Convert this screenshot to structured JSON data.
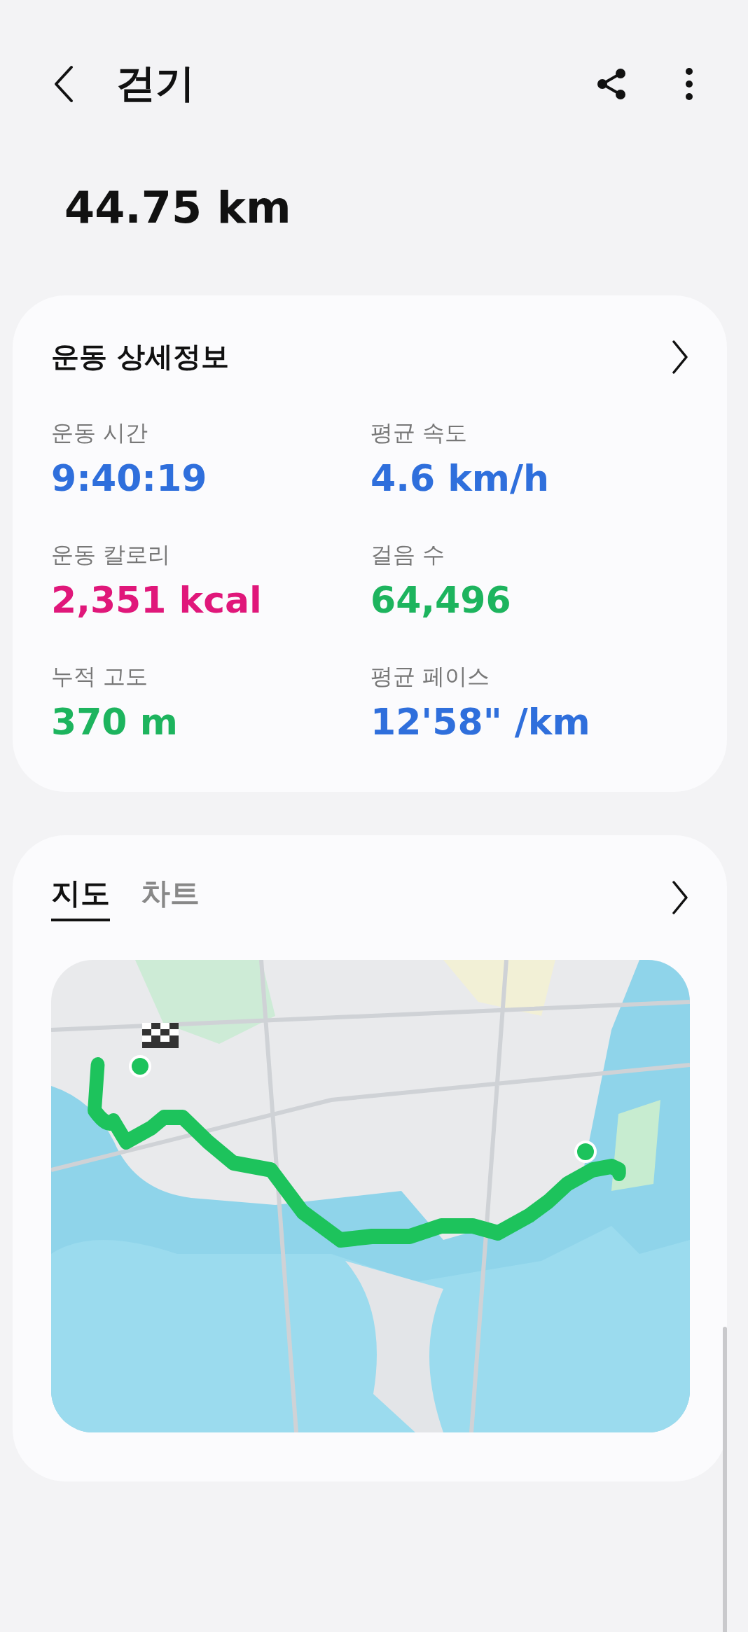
{
  "header": {
    "title": "걷기"
  },
  "distance": "44.75 km",
  "details": {
    "title": "운동 상세정보",
    "stats": [
      {
        "label": "운동 시간",
        "value": "9:40:19",
        "color": "#2f6fdc"
      },
      {
        "label": "평균 속도",
        "value": "4.6 km/h",
        "color": "#2f6fdc"
      },
      {
        "label": "운동 칼로리",
        "value": "2,351 kcal",
        "color": "#e0177a"
      },
      {
        "label": "걸음 수",
        "value": "64,496",
        "color": "#1db45e"
      },
      {
        "label": "누적 고도",
        "value": "370 m",
        "color": "#1db45e"
      },
      {
        "label": "평균 페이스",
        "value": "12'58\" /km",
        "color": "#2f6fdc"
      }
    ]
  },
  "route": {
    "tabs": [
      {
        "label": "지도",
        "selected": true
      },
      {
        "label": "차트",
        "selected": false
      }
    ]
  }
}
